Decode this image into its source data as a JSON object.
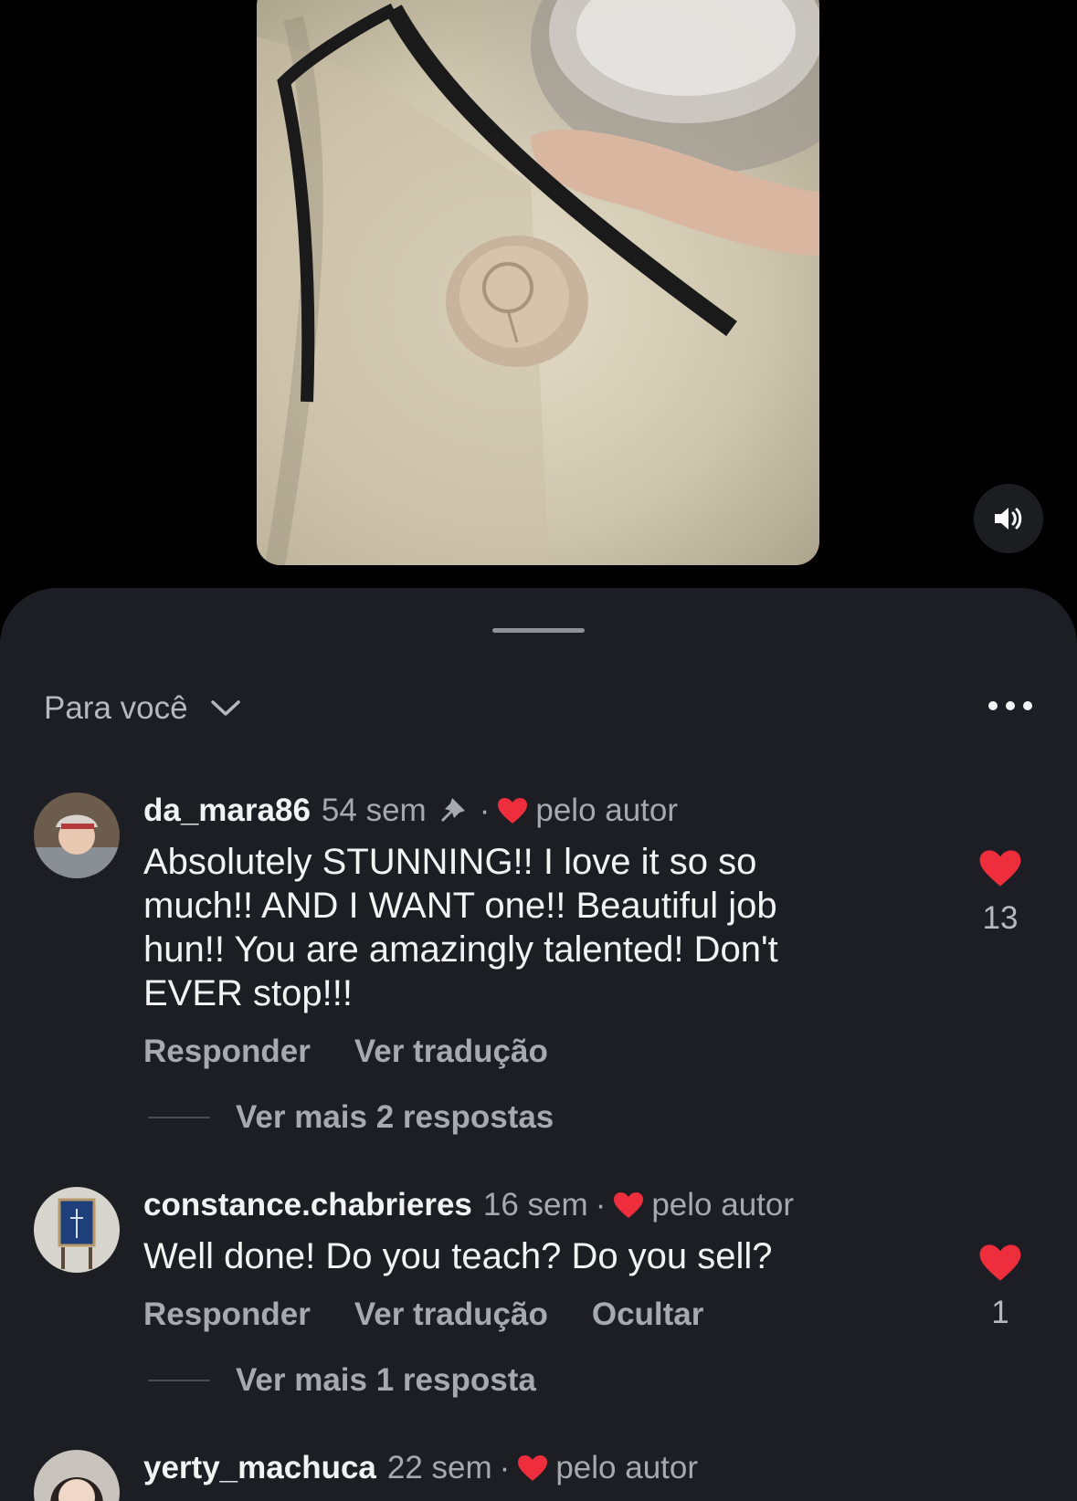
{
  "sheet": {
    "sort_label": "Para você"
  },
  "comments": [
    {
      "username": "da_mara86",
      "time": "54 sem",
      "dot": "·",
      "liked_by_author": "pelo autor",
      "text": "Absolutely STUNNING!! I love it so so much!! AND I WANT one!! Beautiful job hun!! You are amazingly talented!  Don't EVER stop!!!",
      "reply_label": "Responder",
      "translate_label": "Ver tradução",
      "more_replies": "Ver mais 2 respostas",
      "likes": "13"
    },
    {
      "username": "constance.chabrieres",
      "time": "16 sem",
      "dot": "·",
      "liked_by_author": "pelo autor",
      "text": "Well done! Do you teach? Do you sell?",
      "reply_label": "Responder",
      "translate_label": "Ver tradução",
      "hide_label": "Ocultar",
      "more_replies": "Ver mais 1 resposta",
      "likes": "1"
    },
    {
      "username": "yerty_machuca",
      "time": "22 sem",
      "dot": "·",
      "liked_by_author": "pelo autor"
    }
  ],
  "colors": {
    "heart": "#ee2d3d",
    "sheet_bg": "#1c1e23",
    "secondary_text": "#a6a9af"
  }
}
